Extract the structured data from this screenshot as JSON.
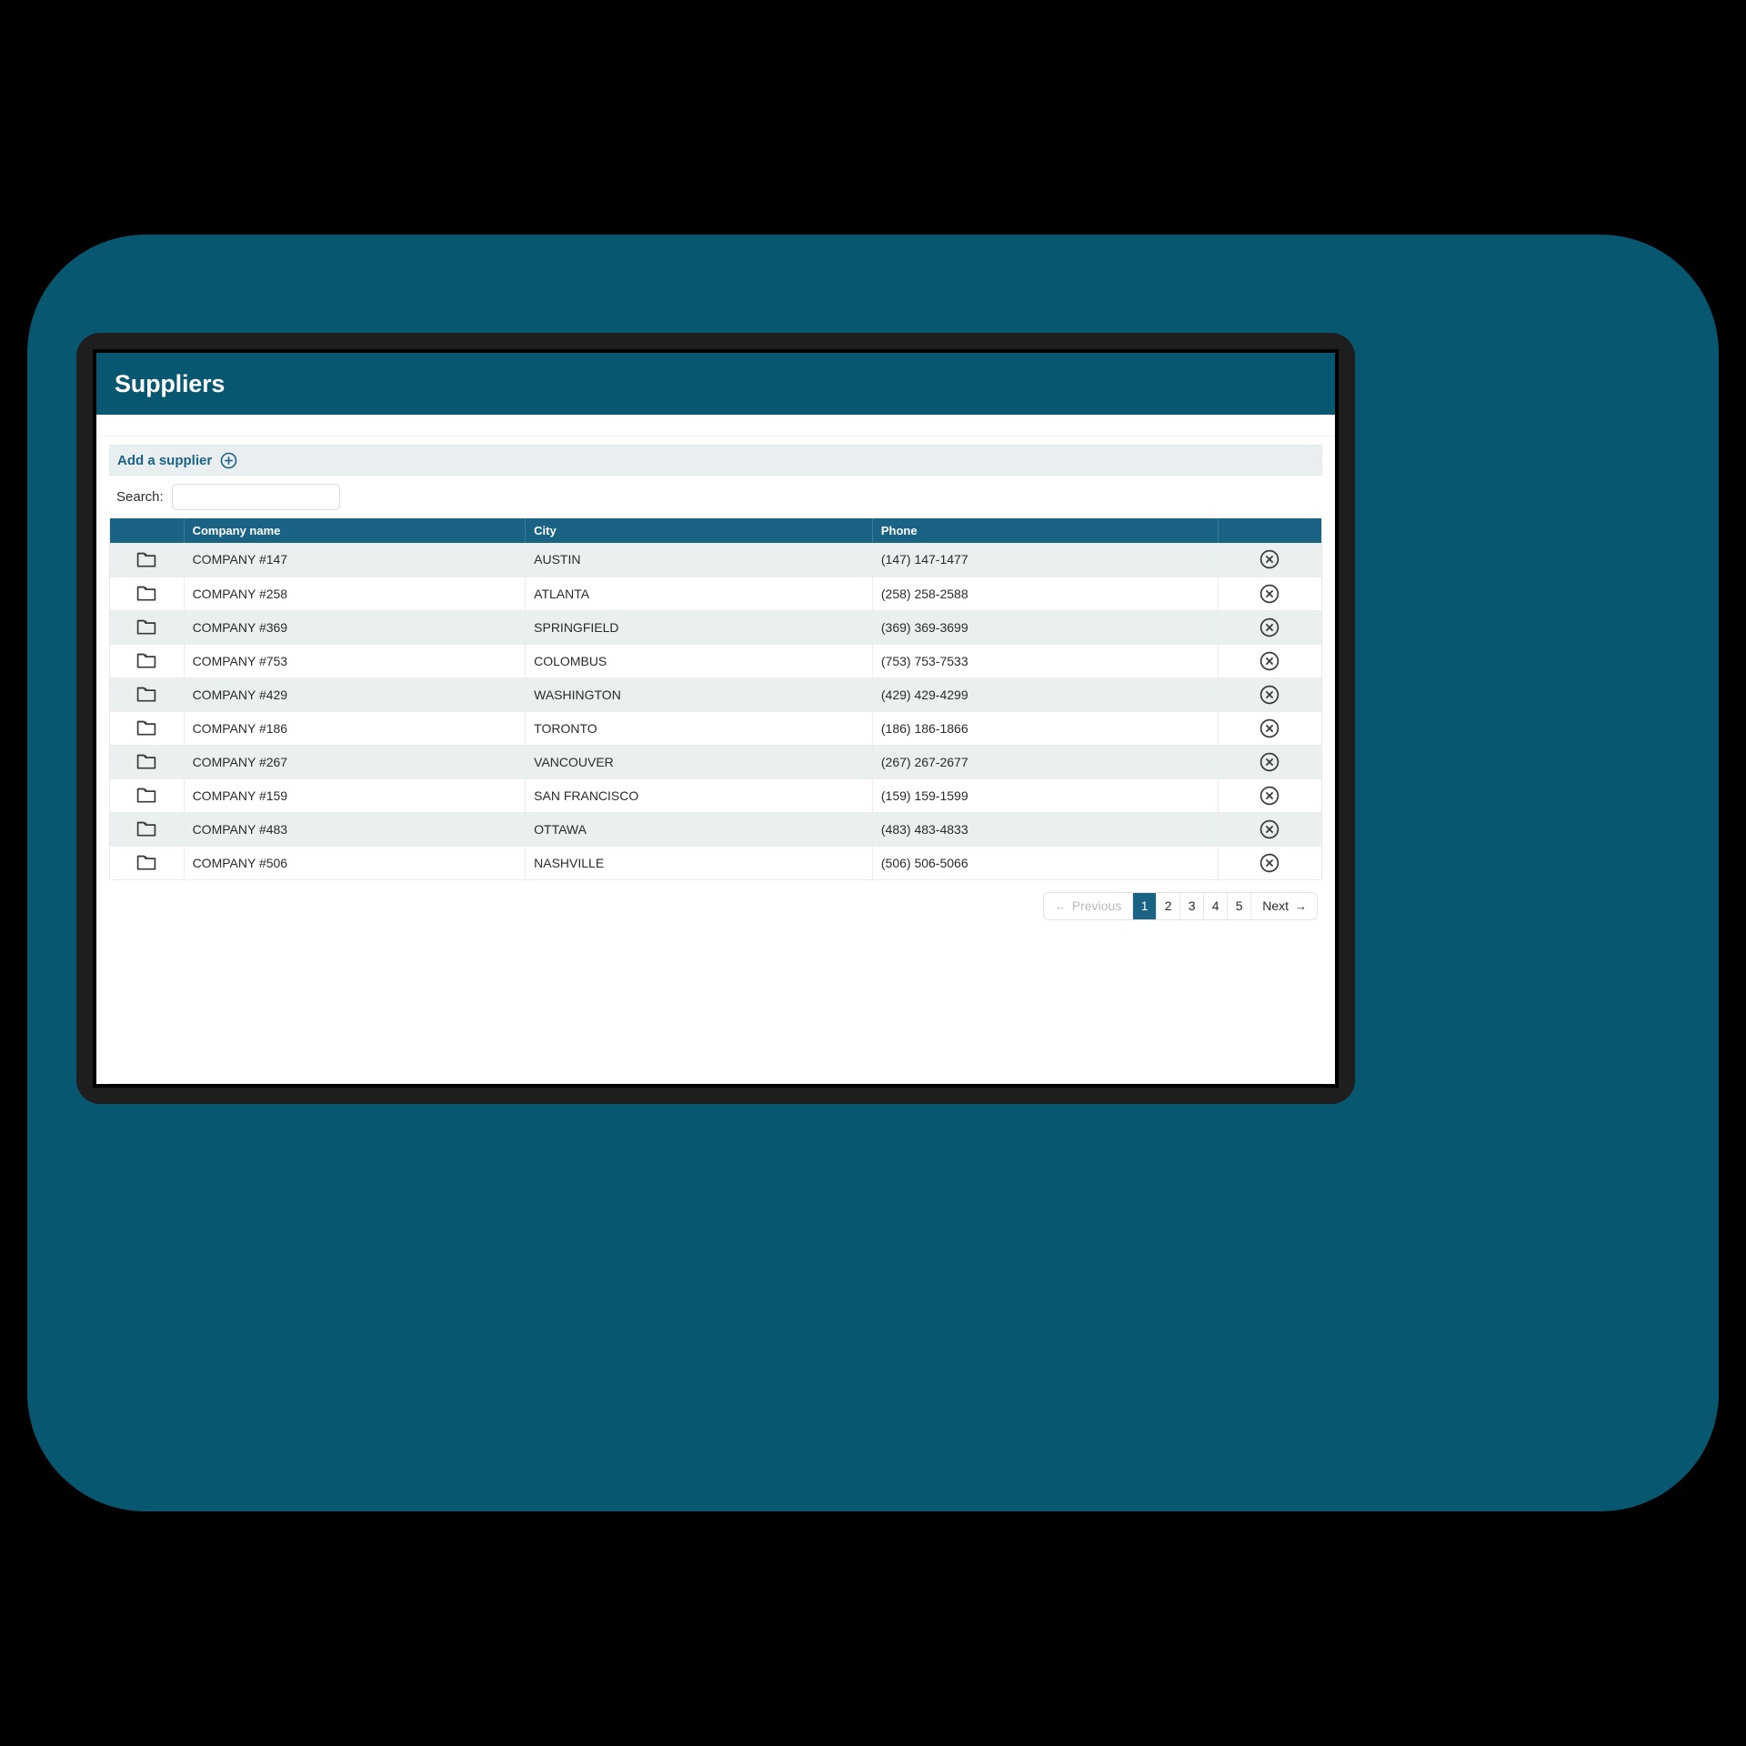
{
  "colors": {
    "backdrop": "#075770",
    "device_frame": "#1e1e1e",
    "app_header": "#075770",
    "table_header": "#1a6384",
    "accent_link": "#1a6384",
    "row_alt": "#eaeff0",
    "add_bar_bg": "#e9eef0"
  },
  "app": {
    "title": "Suppliers"
  },
  "toolbar": {
    "add_supplier_label": "Add a supplier",
    "add_supplier_icon": "plus-circle-icon"
  },
  "search": {
    "label": "Search:",
    "value": "",
    "placeholder": ""
  },
  "table": {
    "columns": [
      {
        "key": "icon",
        "label": ""
      },
      {
        "key": "name",
        "label": "Company name"
      },
      {
        "key": "city",
        "label": "City"
      },
      {
        "key": "phone",
        "label": "Phone"
      },
      {
        "key": "action",
        "label": ""
      }
    ],
    "row_icon": "folder-icon",
    "row_action_icon": "circle-x-delete-icon",
    "rows": [
      {
        "name": "COMPANY #147",
        "city": "AUSTIN",
        "phone": "(147) 147-1477"
      },
      {
        "name": "COMPANY #258",
        "city": "ATLANTA",
        "phone": "(258) 258-2588"
      },
      {
        "name": "COMPANY #369",
        "city": "SPRINGFIELD",
        "phone": "(369) 369-3699"
      },
      {
        "name": "COMPANY #753",
        "city": "COLOMBUS",
        "phone": "(753) 753-7533"
      },
      {
        "name": "COMPANY #429",
        "city": "WASHINGTON",
        "phone": "(429) 429-4299"
      },
      {
        "name": "COMPANY #186",
        "city": "TORONTO",
        "phone": "(186) 186-1866"
      },
      {
        "name": "COMPANY #267",
        "city": "VANCOUVER",
        "phone": "(267) 267-2677"
      },
      {
        "name": "COMPANY #159",
        "city": "SAN FRANCISCO",
        "phone": "(159) 159-1599"
      },
      {
        "name": "COMPANY #483",
        "city": "OTTAWA",
        "phone": "(483) 483-4833"
      },
      {
        "name": "COMPANY #506",
        "city": "NASHVILLE",
        "phone": "(506) 506-5066"
      }
    ]
  },
  "pagination": {
    "previous_label": "Previous",
    "next_label": "Next",
    "previous_arrow": "←",
    "next_arrow": "→",
    "pages": [
      "1",
      "2",
      "3",
      "4",
      "5"
    ],
    "active_page": "1",
    "previous_disabled": true
  }
}
